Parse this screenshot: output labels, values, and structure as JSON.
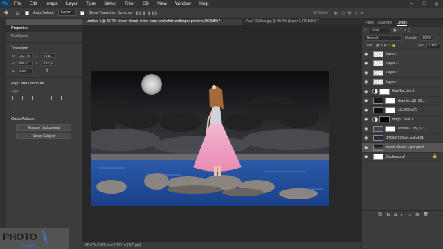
{
  "menubar": {
    "logo": "Ps",
    "items": [
      "File",
      "Edit",
      "Image",
      "Layer",
      "Type",
      "Select",
      "Filter",
      "3D",
      "View",
      "Window",
      "Help"
    ],
    "win_buttons": [
      "–",
      "□",
      "✕"
    ]
  },
  "options": {
    "auto_select_label": "Auto-Select:",
    "auto_select_value": "Layer",
    "show_transform_label": "Show Transform Controls",
    "mode_3d_label": "3D Mode:"
  },
  "doc_tabs": [
    "Untitled-1 @ 66.7% (moon-clouds-in-the-black-and-white-wallpaper-preview, RGB/8#) *",
    "7fuyFC6d9cx.jpg @ 90.4% (Layer 1, RGB/8#) *"
  ],
  "properties": {
    "tabs": [
      "Properties"
    ],
    "layer_type": "Pixel Layer",
    "transform_title": "Transform",
    "w_label": "W",
    "w_value": "1424 px",
    "x_label": "X",
    "x_value": "-73 px",
    "h_label": "H",
    "h_value": "890 px",
    "y_label": "Y",
    "y_value": "-134 px",
    "angle_value": "0.00°",
    "align_title": "Align and Distribute",
    "align_label": "Align:",
    "quick_actions_title": "Quick Actions",
    "remove_bg_label": "Remove Background",
    "select_subject_label": "Select Subject"
  },
  "status": {
    "text": "66.67%   1920 px x 1080 px (300 ppi)"
  },
  "watermark": {
    "brand": "PHOTO",
    "sub": "Tutorials"
  },
  "layers_panel": {
    "tabs": [
      "Paths",
      "Channels",
      "Layers"
    ],
    "active_tab": "Layers",
    "kind_label": "Kind",
    "blend_mode": "Normal",
    "opacity_label": "Opacity:",
    "opacity_value": "100%",
    "lock_label": "Lock:",
    "fill_label": "Fill:",
    "fill_value": "100%",
    "layers": [
      {
        "name": "Layer 1"
      },
      {
        "name": "Layer 3"
      },
      {
        "name": "Layer 2"
      },
      {
        "name": "Layer 4"
      },
      {
        "name": "Hue/Sa...ion 1"
      },
      {
        "name": "downlo...(3)_80..."
      },
      {
        "name": "s7LWbBn7C"
      },
      {
        "name": "Bright...rast 1"
      },
      {
        "name": "coolwal...ix5_823..."
      },
      {
        "name": "1713d7929ad...ce5eb2183d"
      },
      {
        "name": "moon-clouds-...per-preview"
      },
      {
        "name": "Background"
      }
    ],
    "footer_icons": [
      "link-icon",
      "fx",
      "mask",
      "adjustment",
      "group",
      "new-layer",
      "trash"
    ]
  }
}
